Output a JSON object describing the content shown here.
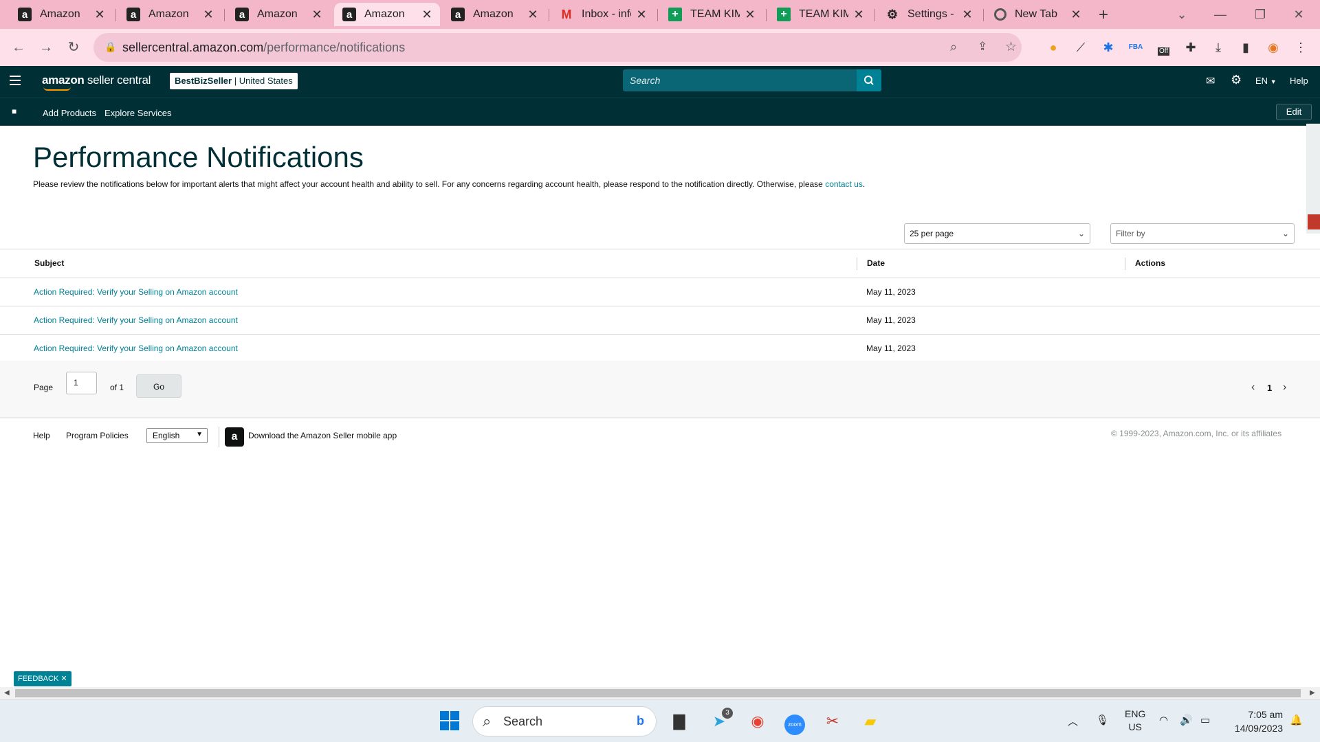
{
  "browser": {
    "tabs": [
      {
        "title": "Amazon",
        "icon": "amazon-icon",
        "active": false
      },
      {
        "title": "Amazon",
        "icon": "amazon-icon",
        "active": false
      },
      {
        "title": "Amazon",
        "icon": "amazon-icon",
        "active": false
      },
      {
        "title": "Amazon",
        "icon": "amazon-icon",
        "active": true
      },
      {
        "title": "Amazon",
        "icon": "amazon-icon",
        "active": false
      },
      {
        "title": "Inbox - info",
        "icon": "gmail-icon",
        "active": false
      },
      {
        "title": "TEAM KIM",
        "icon": "sheets-icon",
        "active": false
      },
      {
        "title": "TEAM KIM",
        "icon": "sheets-icon",
        "active": false
      },
      {
        "title": "Settings - R",
        "icon": "gear-icon",
        "active": false
      },
      {
        "title": "New Tab",
        "icon": "chrome-icon",
        "active": false
      }
    ],
    "url_host": "sellercentral.amazon.com",
    "url_path": "/performance/notifications",
    "extension_badge": "Off"
  },
  "header": {
    "logo_main": "amazon",
    "logo_sub": " seller central",
    "store_name": "BestBizSeller",
    "store_region": " | United States",
    "search_placeholder": "Search",
    "language": "EN",
    "help": "Help"
  },
  "subnav": {
    "items": [
      "Add Products",
      "Explore Services"
    ],
    "edit": "Edit"
  },
  "page": {
    "title": "Performance Notifications",
    "intro": "Please review the notifications below for important alerts that might affect your account health and ability to sell. For any concerns regarding account health, please respond to the notification directly. Otherwise, please ",
    "intro_link": "contact us",
    "intro_end": ".",
    "per_page": "25 per page",
    "filter_placeholder": "Filter by"
  },
  "table": {
    "headers": {
      "subject": "Subject",
      "date": "Date",
      "actions": "Actions"
    },
    "rows": [
      {
        "subject": "Action Required: Verify your Selling on Amazon account",
        "date": "May 11, 2023"
      },
      {
        "subject": "Action Required: Verify your Selling on Amazon account",
        "date": "May 11, 2023"
      },
      {
        "subject": "Action Required: Verify your Selling on Amazon account",
        "date": "May 11, 2023"
      }
    ]
  },
  "pager": {
    "page_label": "Page",
    "page_value": "1",
    "of_label": "of 1",
    "go": "Go",
    "current": "1"
  },
  "footer": {
    "help": "Help",
    "policies": "Program Policies",
    "language": "English",
    "app": "Download the Amazon Seller mobile app",
    "copyright": "© 1999-2023, Amazon.com, Inc. or its affiliates"
  },
  "feedback": "FEEDBACK",
  "taskbar": {
    "search": "Search",
    "telegram_badge": "3",
    "lang_top": "ENG",
    "lang_bottom": "US",
    "time": "7:05 am",
    "date": "14/09/2023"
  },
  "colors": {
    "tabstrip": "#f4b6c9",
    "header": "#002f36",
    "link": "#008296"
  }
}
